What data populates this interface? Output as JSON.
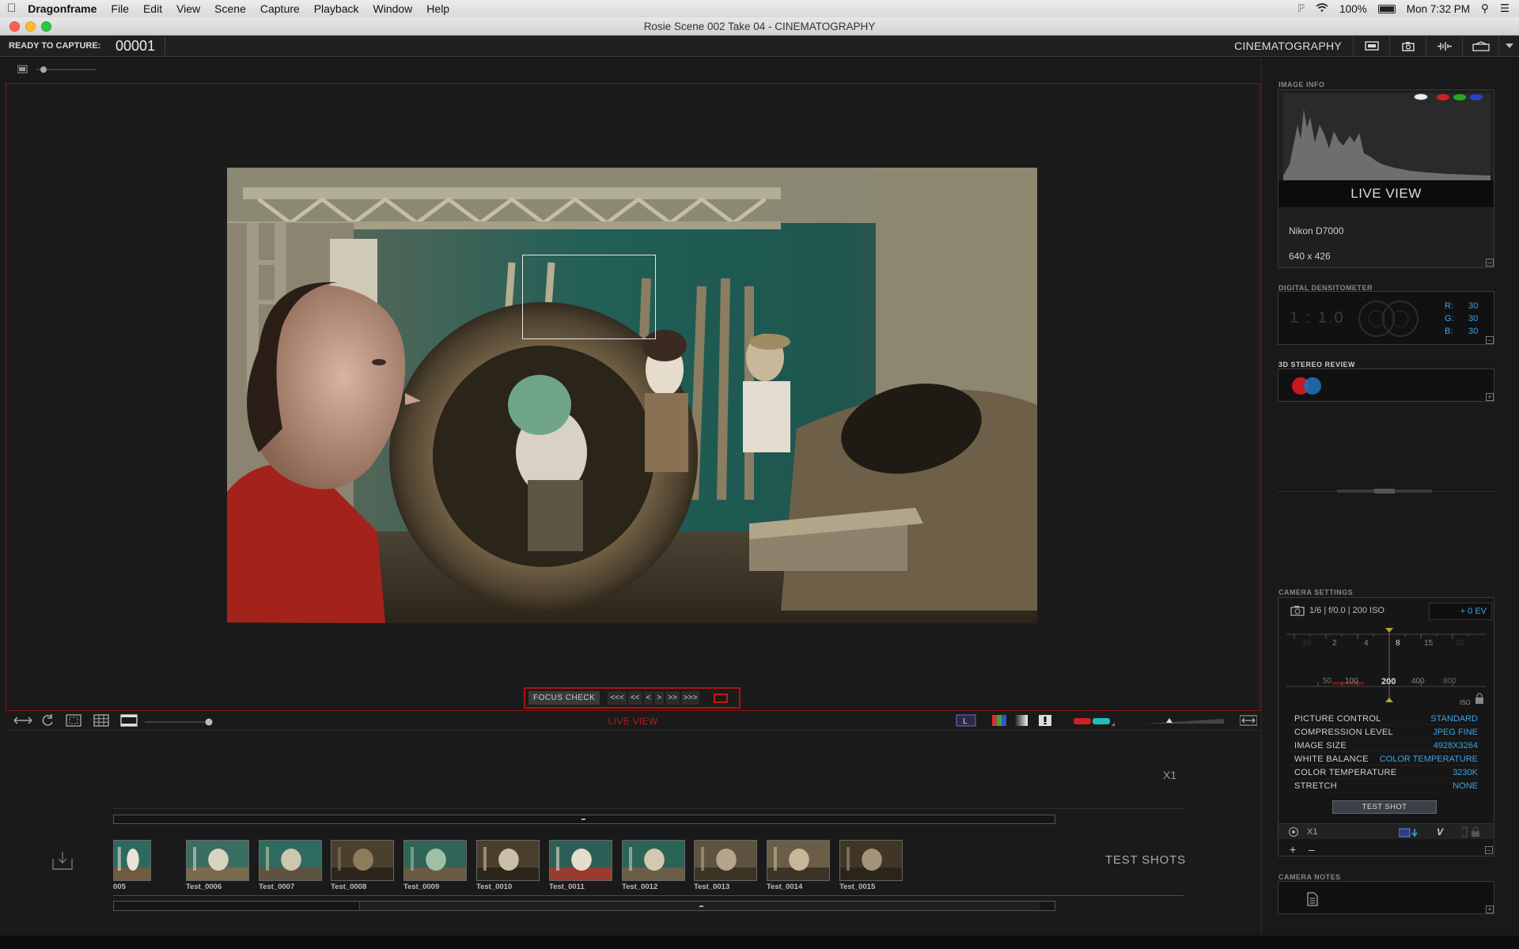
{
  "menubar": {
    "app": "Dragonframe",
    "items": [
      "File",
      "Edit",
      "View",
      "Scene",
      "Capture",
      "Playback",
      "Window",
      "Help"
    ],
    "battery": "100%",
    "clock": "Mon 7:32 PM"
  },
  "window": {
    "title": "Rosie  Scene 002  Take 04 - CINEMATOGRAPHY"
  },
  "topbar": {
    "status": "READY TO CAPTURE:",
    "frame": "00001",
    "workspace": "CINEMATOGRAPHY"
  },
  "viewer": {
    "focus_check": "FOCUS CHECK",
    "nav": [
      "<<<",
      "<<",
      "<",
      ">",
      ">>",
      ">>>"
    ],
    "mode": "LIVE VIEW",
    "exposure_label": "X1"
  },
  "timeline": {
    "section": "TEST SHOTS",
    "thumbs": [
      "005",
      "Test_0006",
      "Test_0007",
      "Test_0008",
      "Test_0009",
      "Test_0010",
      "Test_0011",
      "Test_0012",
      "Test_0013",
      "Test_0014",
      "Test_0015"
    ]
  },
  "image_info": {
    "title": "IMAGE INFO",
    "mode": "LIVE VIEW",
    "camera": "Nikon D7000",
    "size": "640 x 426"
  },
  "densitometer": {
    "title": "DIGITAL DENSITOMETER",
    "ratio": "1 : 1.0",
    "r": "R:",
    "g": "G:",
    "b": "B:",
    "rv": "30",
    "gv": "30",
    "bv": "30"
  },
  "stereo": {
    "title": "3D STEREO REVIEW"
  },
  "camera_settings": {
    "title": "CAMERA SETTINGS",
    "summary": "1/6  |  f/0.0  |  200 ISO",
    "ev": "+ 0 EV",
    "shutter_ticks": [
      "15",
      "2",
      "4",
      "8",
      "15",
      "30"
    ],
    "iso_ticks": [
      "50",
      "100",
      "200",
      "400",
      "800"
    ],
    "iso_label": "ISO",
    "rows": [
      {
        "k": "PICTURE CONTROL",
        "v": "STANDARD"
      },
      {
        "k": "COMPRESSION LEVEL",
        "v": "JPEG FINE"
      },
      {
        "k": "IMAGE SIZE",
        "v": "4928X3264"
      },
      {
        "k": "WHITE BALANCE",
        "v": "COLOR TEMPERATURE"
      },
      {
        "k": "COLOR TEMPERATURE",
        "v": "3230K"
      },
      {
        "k": "STRETCH",
        "v": "NONE"
      }
    ],
    "test_shot": "TEST SHOT",
    "exposure": "X1",
    "v_label": "V"
  },
  "camera_notes": {
    "title": "CAMERA NOTES"
  },
  "colors": {
    "accent_red": "#c01818",
    "value_blue": "#3da3e6"
  }
}
